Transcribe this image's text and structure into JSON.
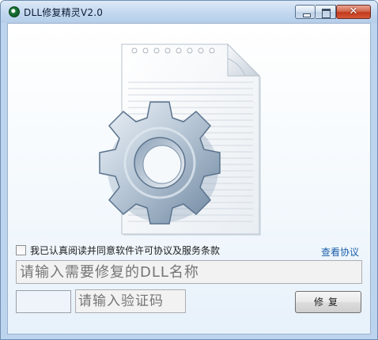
{
  "window": {
    "title": "DLL修复精灵V2.0",
    "icons": {
      "app": "app-icon",
      "minimize": "minimize-icon",
      "maximize": "maximize-icon",
      "close": "close-icon"
    },
    "close_glyph": "✕"
  },
  "illustration": {
    "icons": [
      "document-icon",
      "gear-icon"
    ]
  },
  "agreement": {
    "checked": false,
    "label": "我已认真阅读并同意软件许可协议及服务条款",
    "link_label": "查看协议"
  },
  "dll_input": {
    "placeholder": "请输入需要修复的DLL名称"
  },
  "captcha": {
    "placeholder": "请输入验证码"
  },
  "repair_button": {
    "label": "修复"
  },
  "colors": {
    "accent_link": "#1a5fa8",
    "title_bar": "#c3d8f0",
    "close_button": "#c2391b"
  }
}
